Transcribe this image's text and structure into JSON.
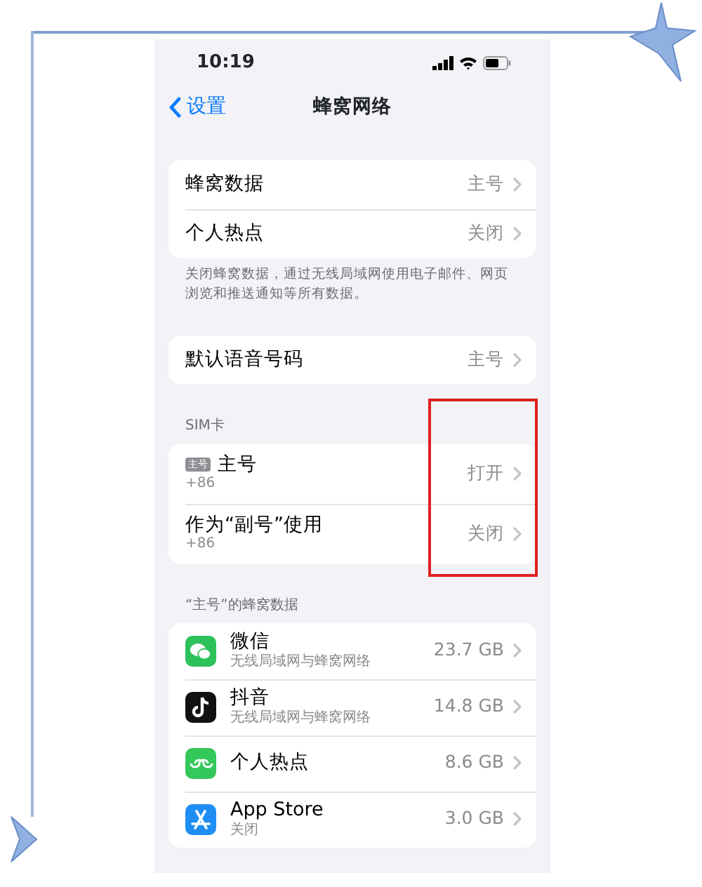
{
  "status_bar": {
    "time": "10:19"
  },
  "nav": {
    "back_label": "设置",
    "title": "蜂窝网络"
  },
  "groups": [
    {
      "rows": [
        {
          "label": "蜂窝数据",
          "value": "主号"
        },
        {
          "label": "个人热点",
          "value": "关闭"
        }
      ],
      "footer": "关闭蜂窝数据，通过无线局域网使用电子邮件、网页浏览和推送通知等所有数据。"
    },
    {
      "rows": [
        {
          "label": "默认语音号码",
          "value": "主号"
        }
      ]
    },
    {
      "header": "SIM卡",
      "annotated": true,
      "rows": [
        {
          "tag": "主号",
          "label": "主号",
          "sublabel": "+86",
          "value": "打开"
        },
        {
          "label": "作为“副号”使用",
          "sublabel": "+86",
          "value": "关闭"
        }
      ]
    },
    {
      "header": "“主号”的蜂窝数据",
      "with_icons": true,
      "rows": [
        {
          "label": "微信",
          "sublabel": "无线局域网与蜂窝网络",
          "value": "23.7 GB"
        },
        {
          "label": "抖音",
          "sublabel": "无线局域网与蜂窝网络",
          "value": "14.8 GB"
        },
        {
          "label": "个人热点",
          "value": "8.6 GB"
        },
        {
          "label": "App Store",
          "sublabel": "关闭",
          "value": "3.0 GB"
        }
      ]
    }
  ]
}
